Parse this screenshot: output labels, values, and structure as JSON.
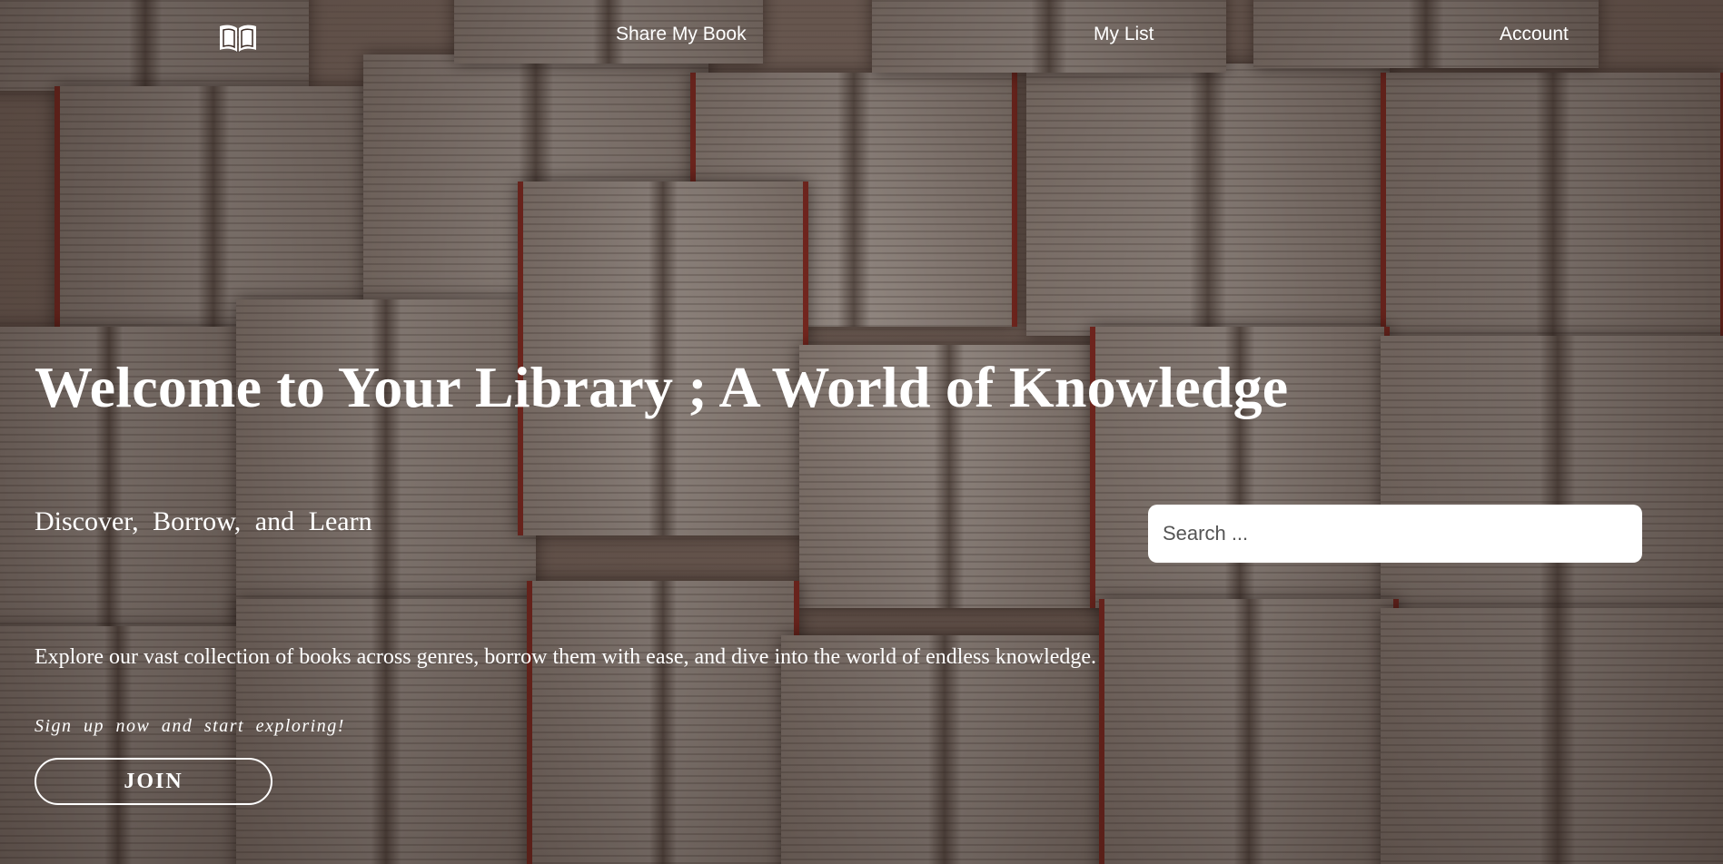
{
  "nav": {
    "logo_icon": "open-book-icon",
    "links": [
      {
        "label": "Share My Book"
      },
      {
        "label": "My List"
      },
      {
        "label": "Account"
      }
    ]
  },
  "hero": {
    "title": "Welcome to Your Library ; A World of Knowledge",
    "subtitle": "Discover, Borrow, and Learn",
    "description": "Explore our vast collection of books across genres, borrow them with ease, and dive into the world of endless knowledge.",
    "cta_text": "Sign up now and start exploring!",
    "join_label": "JOIN"
  },
  "search": {
    "placeholder": "Search ..."
  },
  "colors": {
    "text": "#ffffff",
    "search_bg": "#ffffff",
    "accent_red": "#a8362b"
  }
}
